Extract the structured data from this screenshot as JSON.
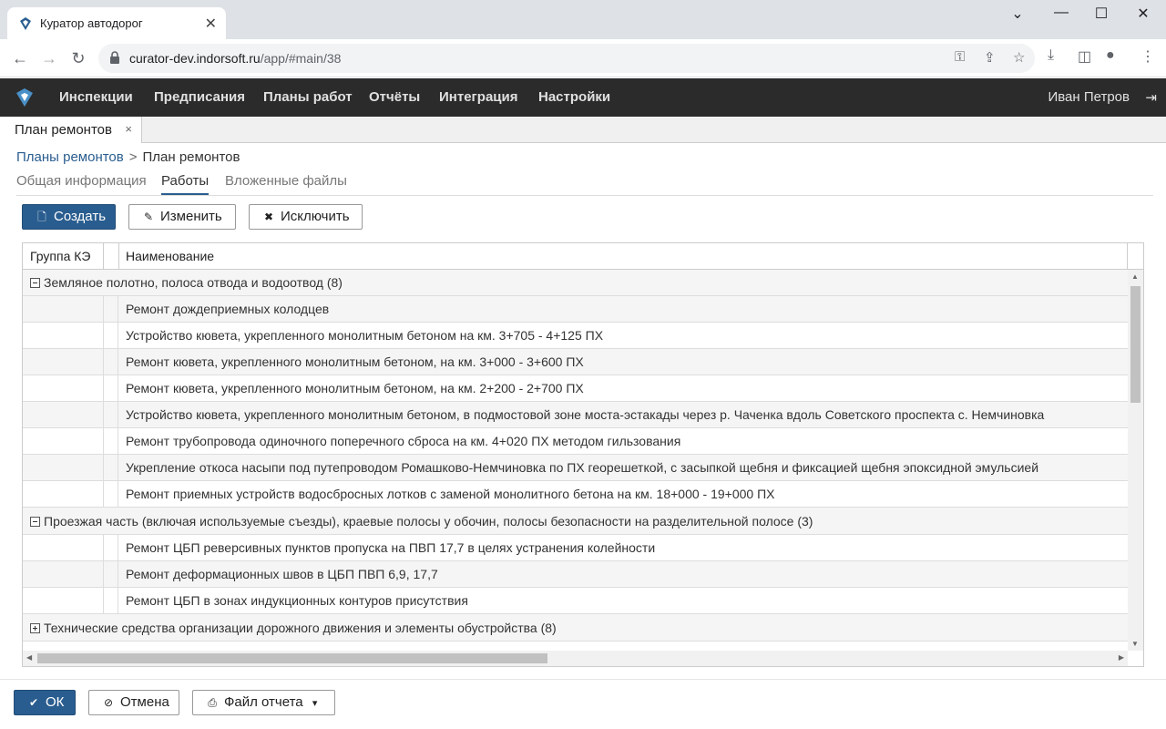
{
  "browser": {
    "tab_title": "Куратор автодорог",
    "url_host": "curator-dev.indorsoft.ru",
    "url_path": "/app/#main/38"
  },
  "nav": {
    "items": [
      "Инспекции",
      "Предписания",
      "Планы работ",
      "Отчёты",
      "Интеграция",
      "Настройки"
    ],
    "user": "Иван Петров"
  },
  "doc_tab": {
    "label": "План ремонтов",
    "close": "×"
  },
  "breadcrumb": {
    "parent": "Планы ремонтов",
    "sep": ">",
    "current": "План ремонтов"
  },
  "subtabs": [
    "Общая информация",
    "Работы",
    "Вложенные файлы"
  ],
  "toolbar": {
    "create": "Создать",
    "edit": "Изменить",
    "exclude": "Исключить"
  },
  "grid": {
    "columns": [
      "Группа КЭ",
      "Наименование"
    ],
    "group1": "Земляное полотно, полоса отвода и водоотвод (8)",
    "group1_rows": [
      "Ремонт дождеприемных колодцев",
      "Устройство кювета, укрепленного монолитным бетоном на км. 3+705 - 4+125 ПХ",
      "Ремонт кювета, укрепленного монолитным бетоном, на км. 3+000 - 3+600 ПХ",
      "Ремонт кювета, укрепленного монолитным бетоном, на км. 2+200 - 2+700 ПХ",
      "Устройство кювета, укрепленного монолитным бетоном, в подмостовой зоне моста-эстакады через р. Чаченка вдоль Советского проспекта с. Немчиновка",
      "Ремонт трубопровода одиночного поперечного сброса на км. 4+020 ПХ методом гильзования",
      "Укрепление откоса насыпи под путепроводом Ромашково-Немчиновка по ПХ георешеткой, с засыпкой щебня и фиксацией щебня эпоксидной эмульсией",
      "Ремонт приемных устройств водосбросных лотков с заменой монолитного бетона на км. 18+000 - 19+000 ПХ"
    ],
    "group2": "Проезжая часть (включая используемые съезды), краевые полосы у обочин, полосы безопасности на разделительной полосе (3)",
    "group2_rows": [
      "Ремонт ЦБП реверсивных пунктов пропуска на ПВП 17,7 в целях устранения колейности",
      "Ремонт деформационных швов в ЦБП ПВП 6,9, 17,7",
      "Ремонт ЦБП в зонах индукционных контуров присутствия"
    ],
    "group3": "Технические средства организации дорожного движения и элементы обустройства (8)"
  },
  "footer": {
    "ok": "ОК",
    "cancel": "Отмена",
    "report": "Файл отчета"
  }
}
